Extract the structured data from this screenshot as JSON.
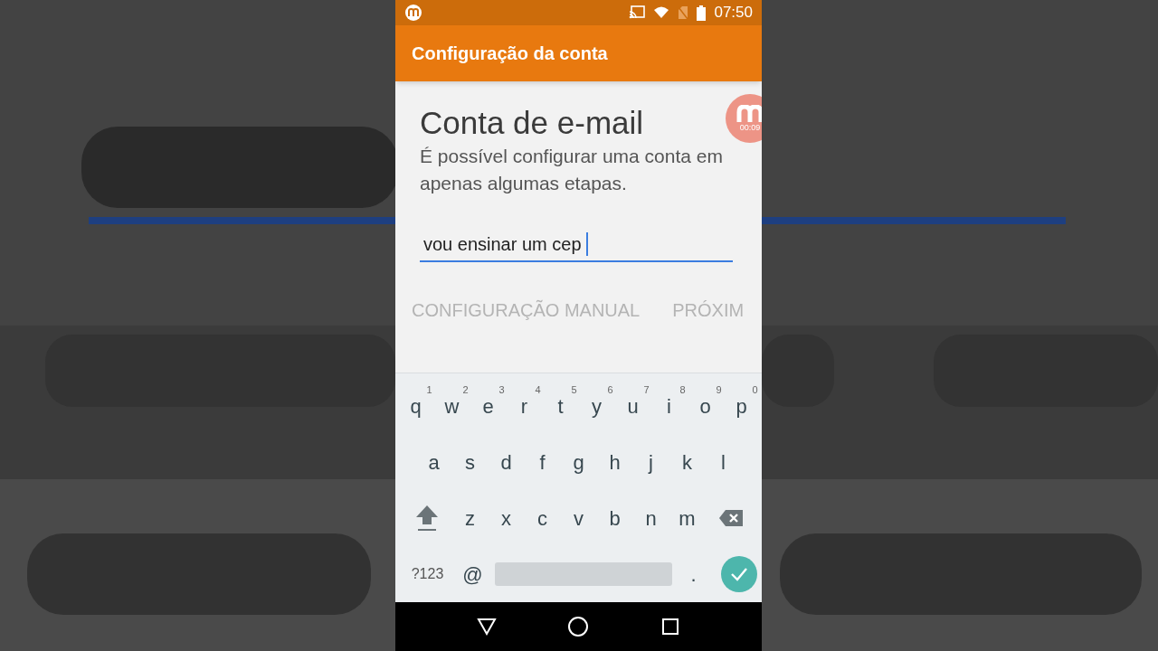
{
  "status_bar": {
    "time": "07:50"
  },
  "app_bar": {
    "title": "Configuração da conta"
  },
  "heading": "Conta de e-mail",
  "description": "É possível configurar uma conta em apenas algumas etapas.",
  "email_field": {
    "value": "vou ensinar um cep",
    "focused": true
  },
  "buttons": [
    {
      "label": "CONFIGURAÇÃO MANUAL"
    },
    {
      "label": "PRÓXIM"
    }
  ],
  "recorder_bubble": {
    "timer": "00:09"
  },
  "keyboard": {
    "rows": [
      [
        {
          "kind": "letter",
          "label": "q",
          "hint": "1"
        },
        {
          "kind": "letter",
          "label": "w",
          "hint": "2"
        },
        {
          "kind": "letter",
          "label": "e",
          "hint": "3"
        },
        {
          "kind": "letter",
          "label": "r",
          "hint": "4"
        },
        {
          "kind": "letter",
          "label": "t",
          "hint": "5"
        },
        {
          "kind": "letter",
          "label": "y",
          "hint": "6"
        },
        {
          "kind": "letter",
          "label": "u",
          "hint": "7"
        },
        {
          "kind": "letter",
          "label": "i",
          "hint": "8"
        },
        {
          "kind": "letter",
          "label": "o",
          "hint": "9"
        },
        {
          "kind": "letter",
          "label": "p",
          "hint": "0"
        }
      ],
      [
        {
          "kind": "letter",
          "label": "a"
        },
        {
          "kind": "letter",
          "label": "s"
        },
        {
          "kind": "letter",
          "label": "d"
        },
        {
          "kind": "letter",
          "label": "f"
        },
        {
          "kind": "letter",
          "label": "g"
        },
        {
          "kind": "letter",
          "label": "h"
        },
        {
          "kind": "letter",
          "label": "j"
        },
        {
          "kind": "letter",
          "label": "k"
        },
        {
          "kind": "letter",
          "label": "l"
        }
      ],
      [
        {
          "kind": "shift"
        },
        {
          "kind": "letter",
          "label": "z"
        },
        {
          "kind": "letter",
          "label": "x"
        },
        {
          "kind": "letter",
          "label": "c"
        },
        {
          "kind": "letter",
          "label": "v"
        },
        {
          "kind": "letter",
          "label": "b"
        },
        {
          "kind": "letter",
          "label": "n"
        },
        {
          "kind": "letter",
          "label": "m"
        },
        {
          "kind": "backspace"
        }
      ],
      [
        {
          "kind": "symbols",
          "label": "?123"
        },
        {
          "kind": "letter",
          "label": "@"
        },
        {
          "kind": "space"
        },
        {
          "kind": "letter",
          "label": "."
        },
        {
          "kind": "enter"
        }
      ]
    ]
  }
}
